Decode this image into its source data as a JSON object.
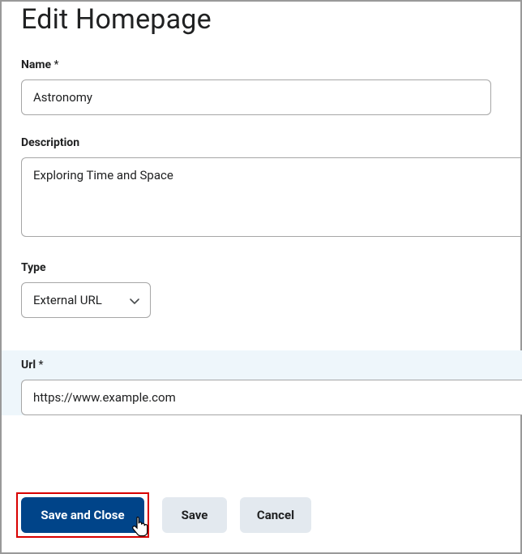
{
  "page_title": "Edit Homepage",
  "fields": {
    "name": {
      "label": "Name",
      "required": "*",
      "value": "Astronomy"
    },
    "description": {
      "label": "Description",
      "value": "Exploring Time and Space"
    },
    "type": {
      "label": "Type",
      "value": "External URL"
    },
    "url": {
      "label": "Url",
      "required": "*",
      "value": "https://www.example.com"
    }
  },
  "buttons": {
    "save_and_close": "Save and Close",
    "save": "Save",
    "cancel": "Cancel"
  }
}
